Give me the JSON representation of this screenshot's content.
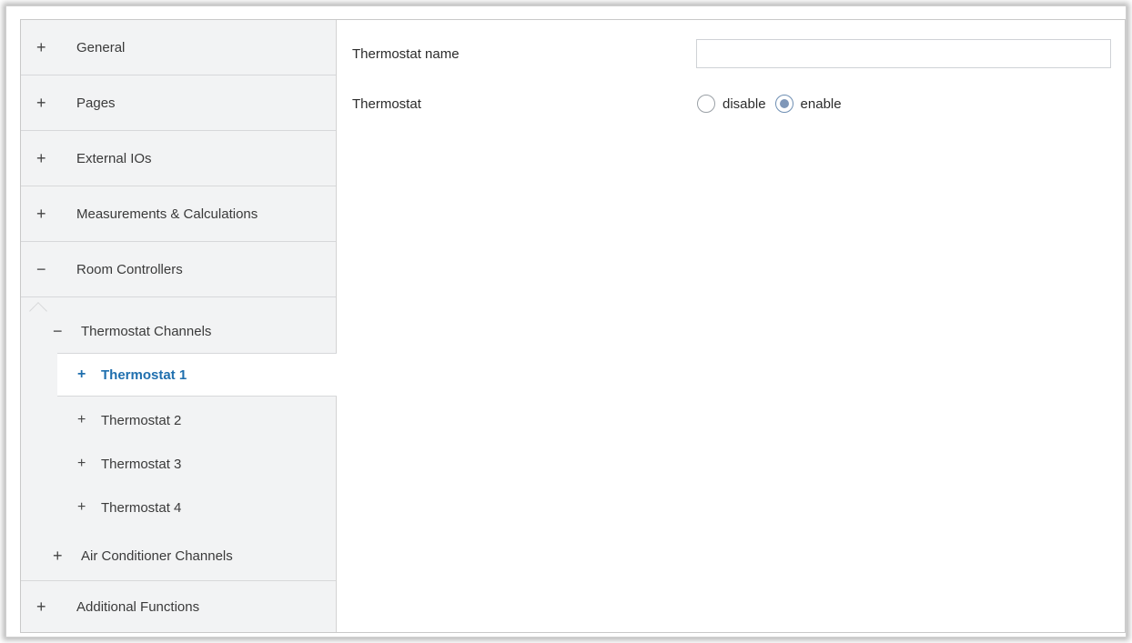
{
  "sidebar": {
    "top_items": [
      {
        "symbol": "+",
        "label": "General"
      },
      {
        "symbol": "+",
        "label": "Pages"
      },
      {
        "symbol": "+",
        "label": "External IOs"
      },
      {
        "symbol": "+",
        "label": "Measurements & Calculations"
      },
      {
        "symbol": "−",
        "label": "Room Controllers"
      }
    ],
    "thermostat_channels": {
      "symbol": "−",
      "label": "Thermostat Channels"
    },
    "thermostats": [
      {
        "symbol": "+",
        "label": "Thermostat 1",
        "selected": true
      },
      {
        "symbol": "+",
        "label": "Thermostat 2"
      },
      {
        "symbol": "+",
        "label": "Thermostat 3"
      },
      {
        "symbol": "+",
        "label": "Thermostat 4"
      }
    ],
    "air_conditioner_channels": {
      "symbol": "+",
      "label": "Air Conditioner Channels"
    },
    "additional_functions": {
      "symbol": "+",
      "label": "Additional Functions"
    }
  },
  "form": {
    "thermostat_name": {
      "label": "Thermostat name",
      "value": "",
      "placeholder": ""
    },
    "thermostat": {
      "label": "Thermostat",
      "options": [
        {
          "label": "disable",
          "checked": false
        },
        {
          "label": "enable",
          "checked": true
        }
      ]
    }
  },
  "colors": {
    "sidebar_bg": "#f2f3f4",
    "selected_text": "#1f6fae",
    "radio_checked": "#7f97b8"
  }
}
